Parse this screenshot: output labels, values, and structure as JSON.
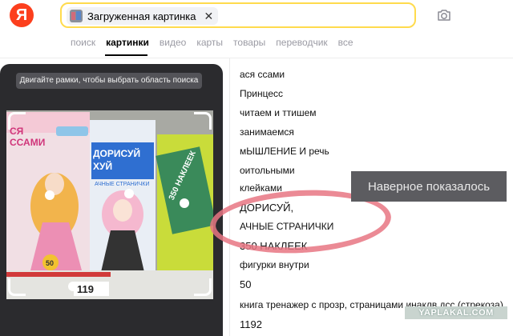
{
  "header": {
    "logo_letter": "Я",
    "search": {
      "chip_label": "Загруженная картинка",
      "chip_close": "✕"
    },
    "camera_icon": "camera-icon"
  },
  "tabs": [
    {
      "label": "поиск"
    },
    {
      "label": "картинки",
      "active": true
    },
    {
      "label": "видео"
    },
    {
      "label": "карты"
    },
    {
      "label": "товары"
    },
    {
      "label": "переводчик"
    },
    {
      "label": "все"
    }
  ],
  "left_panel": {
    "hint": "Двигайте рамки, чтобы выбрать область поиска",
    "photo_texts": {
      "book1_line1": "СЯ",
      "book1_line2": "ССАМИ",
      "book2_line1": "ДОРИСУЙ",
      "book2_line2": "ХУЙ",
      "book2_line3": "АЧНЫЕ СТРАНИЧКИ",
      "book3_line": "350 НАКЛЕЕК",
      "price": "119",
      "badge": "50"
    }
  },
  "recognized_text": [
    "ася ссами",
    "Принцесс",
    "читаем и ттишем",
    "занимаемся",
    "мЫШЛЕНИЕ И речь",
    "оитольными",
    "клейками",
    "ДОРИСУЙ,",
    "АЧНЫЕ СТРАНИЧКИ",
    "350 НАКЛЕЕК",
    "фигурки внутри",
    "50",
    "книга тренажер с прозр, страницами инаклв дсс (стрекоза)",
    "1192"
  ],
  "overlay_caption": "Наверное показалось",
  "watermark": "YAPLAKAL.COM",
  "colors": {
    "brand": "#fc3f1d",
    "search_border": "#ffdb4d",
    "annotation": "#e87682"
  }
}
